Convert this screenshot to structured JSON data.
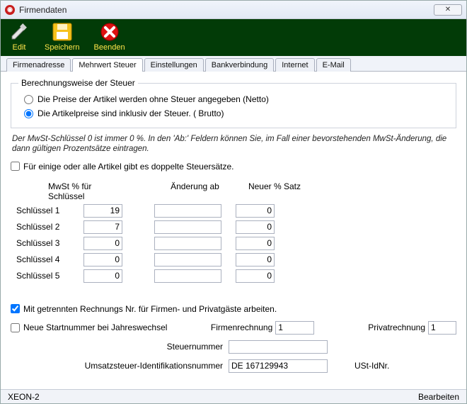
{
  "window": {
    "title": "Firmendaten"
  },
  "toolbar": {
    "edit_label": "Edit",
    "save_label": "Speichern",
    "exit_label": "Beenden"
  },
  "tabs": {
    "t0": "Firmenadresse",
    "t1": "Mehrwert Steuer",
    "t2": "Einstellungen",
    "t3": "Bankverbindung",
    "t4": "Internet",
    "t5": "E-Mail"
  },
  "calc": {
    "legend": "Berechnungsweise der Steuer",
    "opt_net": "Die Preise der Artikel werden ohne Steuer angegeben (Netto)",
    "opt_gross": "Die Artikelpreise sind inklusiv der Steuer. ( Brutto)"
  },
  "note": "Der MwSt-Schlüssel 0 ist immer 0 %. In den 'Ab:' Feldern können Sie, im Fall einer bevorstehenden MwSt-Änderung, die dann gültigen Prozentsätze eintragen.",
  "double_rates_label": "Für einige oder alle Artikel gibt es doppelte Steuersätze.",
  "grid": {
    "head_main": "MwSt % für Schlüssel",
    "head_change": "Änderung ab",
    "head_new": "Neuer % Satz",
    "rows": [
      {
        "label": "Schlüssel 1",
        "pct": "19",
        "date": "",
        "newpct": "0"
      },
      {
        "label": "Schlüssel 2",
        "pct": "7",
        "date": "",
        "newpct": "0"
      },
      {
        "label": "Schlüssel 3",
        "pct": "0",
        "date": "",
        "newpct": "0"
      },
      {
        "label": "Schlüssel 4",
        "pct": "0",
        "date": "",
        "newpct": "0"
      },
      {
        "label": "Schlüssel 5",
        "pct": "0",
        "date": "",
        "newpct": "0"
      }
    ]
  },
  "bottom": {
    "sep_invoice_label": "Mit getrennten Rechnungs Nr. für Firmen- und Privatgäste arbeiten.",
    "new_start_label": "Neue Startnummer bei Jahreswechsel",
    "company_invoice_label": "Firmenrechnung",
    "company_invoice_value": "1",
    "private_invoice_label": "Privatrechnung",
    "private_invoice_value": "1",
    "tax_number_label": "Steuernummer",
    "tax_number_value": "",
    "vat_id_label": "Umsatzsteuer-Identifikationsnummer",
    "vat_id_value": "DE 167129943",
    "vat_id_suffix": "USt-IdNr."
  },
  "status": {
    "left": "XEON-2",
    "right": "Bearbeiten"
  }
}
